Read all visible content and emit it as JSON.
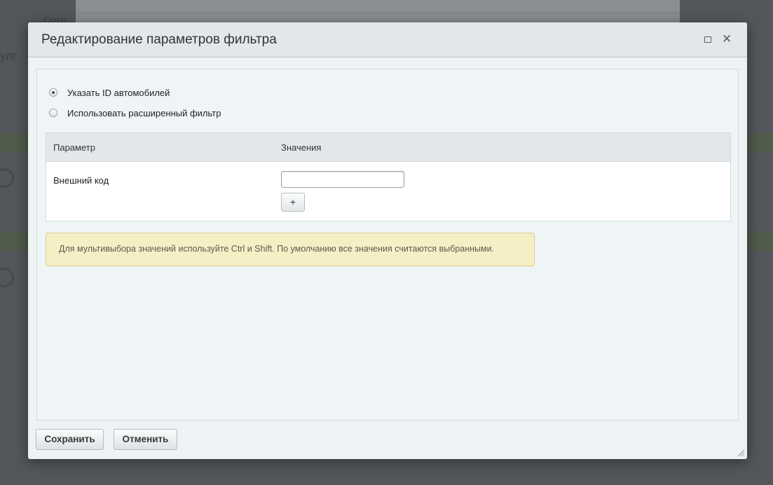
{
  "dialog": {
    "title": "Редактирование параметров фильтра"
  },
  "filter_mode": {
    "options": [
      {
        "label": "Указать ID автомобилей",
        "checked": true
      },
      {
        "label": "Использовать расширенный фильтр",
        "checked": false
      }
    ]
  },
  "table": {
    "headers": [
      "Параметр",
      "Значения"
    ],
    "rows": [
      {
        "param": "Внешний код",
        "value": ""
      }
    ],
    "add_button_label": "+"
  },
  "hint": "Для мультивыбора значений используйте Ctrl и Shift. По умолчанию все значения считаются выбранными.",
  "footer": {
    "save_label": "Сохранить",
    "cancel_label": "Отменить"
  },
  "background": {
    "fragment_1": "улг",
    "fragment_2": "Сохр"
  },
  "colors": {
    "overlay": "#53575b",
    "dialog_bg": "#eef2f4",
    "header_bg": "#e2e8ea",
    "hint_bg": "#f6efc6",
    "hint_border": "#d8cc8e"
  }
}
